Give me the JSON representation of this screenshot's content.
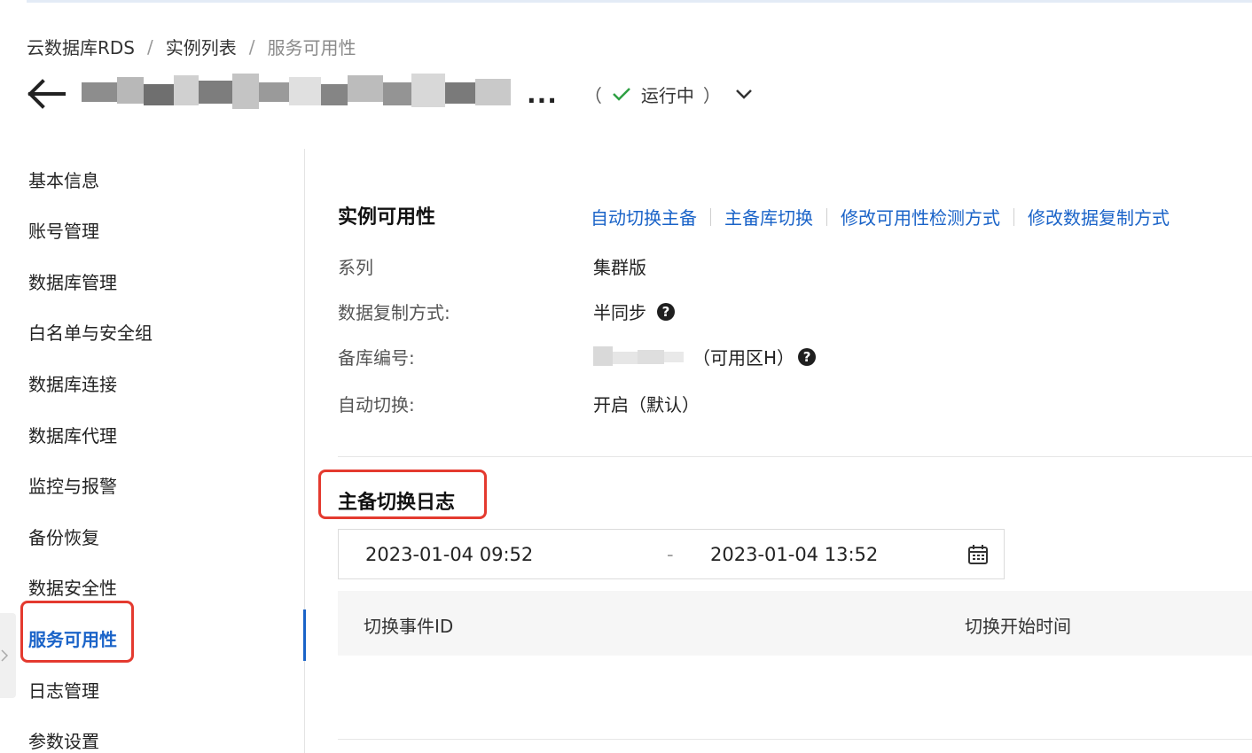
{
  "breadcrumb": {
    "items": [
      "云数据库RDS",
      "实例列表",
      "服务可用性"
    ],
    "separator": "/"
  },
  "header": {
    "instance_name_suffix": "...",
    "status_open": "（",
    "status_text": "运行中",
    "status_close": "）"
  },
  "sidebar": {
    "items": [
      {
        "label": "基本信息"
      },
      {
        "label": "账号管理"
      },
      {
        "label": "数据库管理"
      },
      {
        "label": "白名单与安全组"
      },
      {
        "label": "数据库连接"
      },
      {
        "label": "数据库代理"
      },
      {
        "label": "监控与报警"
      },
      {
        "label": "备份恢复"
      },
      {
        "label": "数据安全性"
      },
      {
        "label": "服务可用性"
      },
      {
        "label": "日志管理"
      },
      {
        "label": "参数设置"
      }
    ],
    "active_index": 9
  },
  "availability": {
    "title": "实例可用性",
    "actions": [
      "自动切换主备",
      "主备库切换",
      "修改可用性检测方式",
      "修改数据复制方式"
    ],
    "rows": [
      {
        "label": "系列",
        "value": "集群版"
      },
      {
        "label": "数据复制方式:",
        "value": "半同步"
      },
      {
        "label": "备库编号:",
        "value": "（可用区H）"
      },
      {
        "label": "自动切换:",
        "value": "开启（默认）"
      }
    ],
    "help_icon": "?"
  },
  "switch_log": {
    "title": "主备切换日志",
    "date_start": "2023-01-04 09:52",
    "date_separator": "-",
    "date_end": "2023-01-04 13:52",
    "columns": [
      "切换事件ID",
      "切换开始时间"
    ]
  },
  "colors": {
    "accent": "#1a63c8",
    "highlight_box": "#e43a2f",
    "status_ok": "#2ea043"
  }
}
